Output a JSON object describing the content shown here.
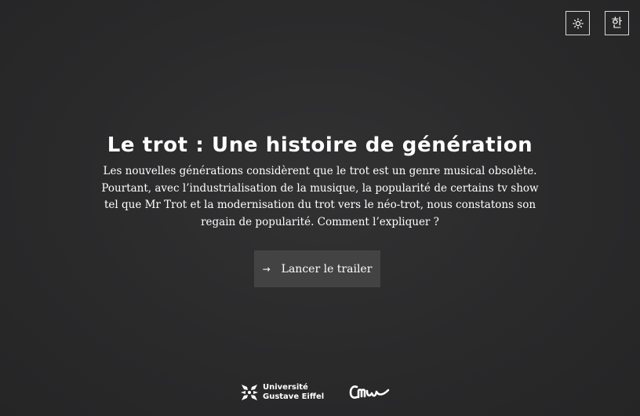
{
  "controls": {
    "theme_icon": "sun-icon",
    "language_label": "한"
  },
  "hero": {
    "title": "Le trot : Une histoire de génération",
    "description": "Les nouvelles générations considèrent que le trot est un genre musical obsolète. Pourtant, avec l’industrialisation de la musique, la popularité de certains tv show tel que Mr Trot et la modernisation du trot vers le néo-trot, nous constatons son regain de popularité. Comment l’expliquer ?"
  },
  "cta": {
    "arrow": "→",
    "label": "Lancer le trailer"
  },
  "footer": {
    "university_line1": "Université",
    "university_line2": "Gustave Eiffel",
    "partner_logo": "Cmw"
  },
  "colors": {
    "background": "#2a2a2b",
    "button_bg": "#434344",
    "text": "#ffffff"
  }
}
